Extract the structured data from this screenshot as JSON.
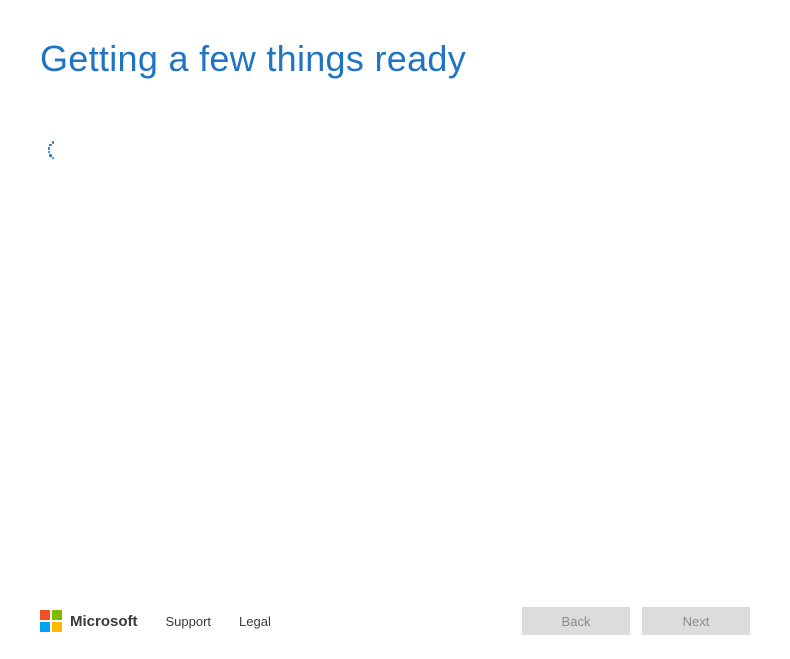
{
  "header": {
    "title": "Getting a few things ready"
  },
  "footer": {
    "brand": "Microsoft",
    "support_label": "Support",
    "legal_label": "Legal",
    "back_label": "Back",
    "next_label": "Next"
  },
  "colors": {
    "accent": "#1f74c4"
  }
}
